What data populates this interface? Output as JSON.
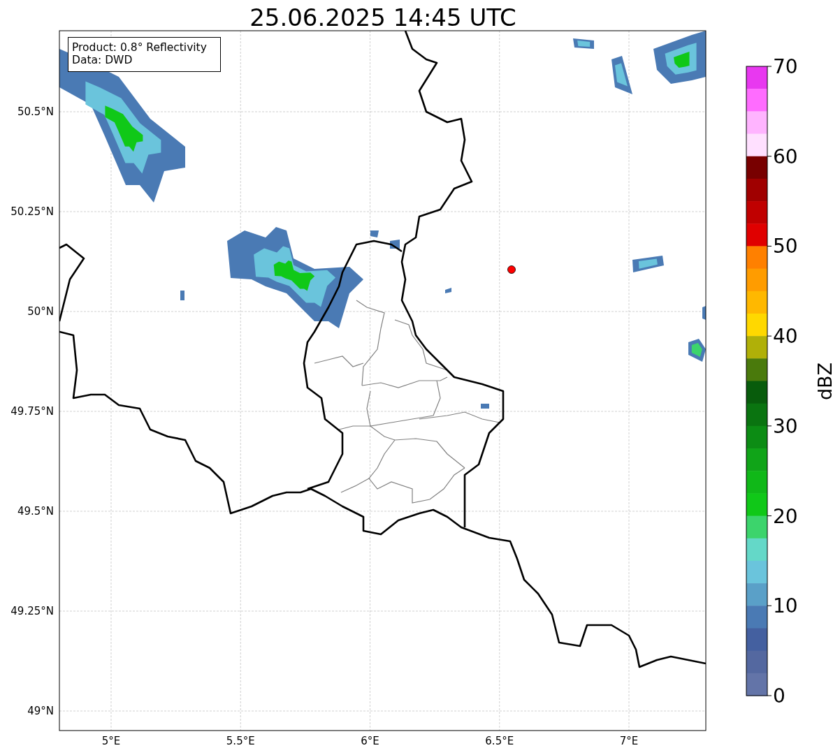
{
  "title": "25.06.2025 14:45 UTC",
  "info_box": [
    "Product: 0.8° Reflectivity",
    "Data: DWD"
  ],
  "map": {
    "lat_ticks": [
      "50.5°N",
      "50.25°N",
      "50°N",
      "49.75°N",
      "49.5°N",
      "49.25°N",
      "49°N"
    ],
    "lon_ticks": [
      "5°E",
      "5.5°E",
      "6°E",
      "6.5°E",
      "7°E"
    ]
  },
  "colorbar": {
    "label": "dBZ",
    "ticks": [
      "70",
      "60",
      "50",
      "40",
      "30",
      "20",
      "10",
      "0"
    ],
    "levels": [
      {
        "color": "#e838f0"
      },
      {
        "color": "#ff6cff"
      },
      {
        "color": "#ffb4ff"
      },
      {
        "color": "#ffe0ff"
      },
      {
        "color": "#780000"
      },
      {
        "color": "#a00000"
      },
      {
        "color": "#c00000"
      },
      {
        "color": "#e00000"
      },
      {
        "color": "#ff8000"
      },
      {
        "color": "#ff9c00"
      },
      {
        "color": "#ffb800"
      },
      {
        "color": "#ffd800"
      },
      {
        "color": "#b0b008"
      },
      {
        "color": "#4a7a0c"
      },
      {
        "color": "#085c0c"
      },
      {
        "color": "#0a7410"
      },
      {
        "color": "#0c8c14"
      },
      {
        "color": "#10a418"
      },
      {
        "color": "#10b818"
      },
      {
        "color": "#10c818"
      },
      {
        "color": "#3cd46c"
      },
      {
        "color": "#64d8c8"
      },
      {
        "color": "#6ac4dc"
      },
      {
        "color": "#5aa0c8"
      },
      {
        "color": "#4a7ab4"
      },
      {
        "color": "#4460a0"
      },
      {
        "color": "#5468a0"
      },
      {
        "color": "#6374a8"
      }
    ]
  }
}
